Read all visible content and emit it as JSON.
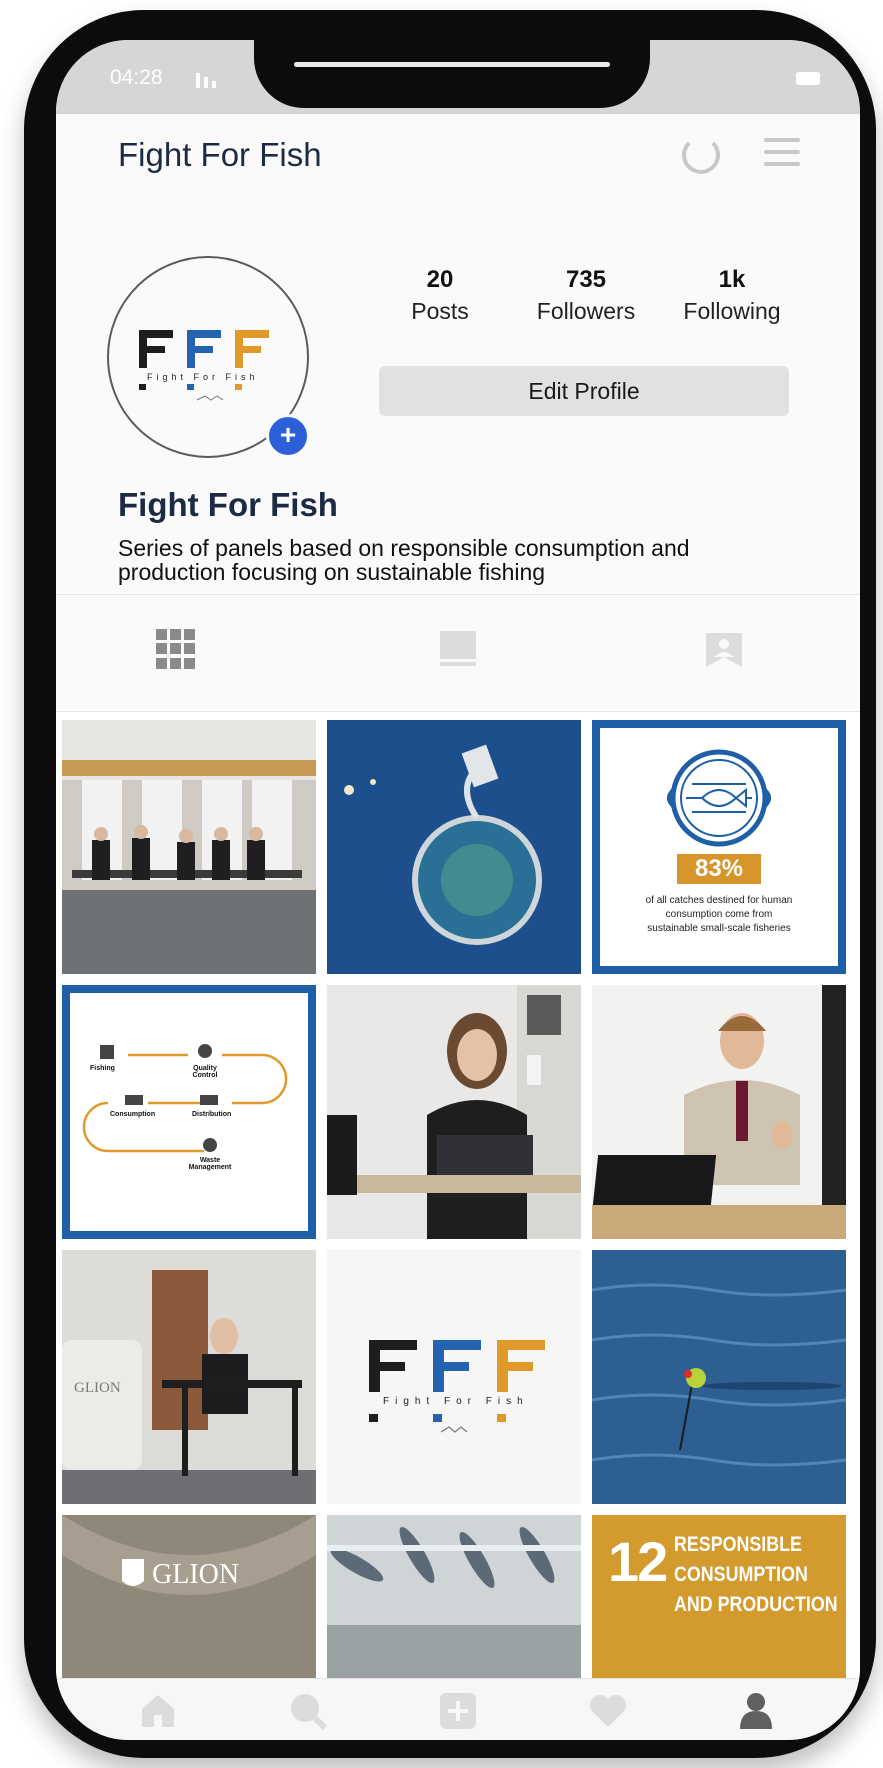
{
  "status": {
    "time": "04:28"
  },
  "header": {
    "title": "Fight For Fish"
  },
  "profile": {
    "stats": [
      {
        "value": "20",
        "label": "Posts"
      },
      {
        "value": "735",
        "label": "Followers"
      },
      {
        "value": "1k",
        "label": "Following"
      }
    ],
    "edit_label": "Edit Profile",
    "name": "Fight For Fish",
    "bio": "Series of panels based on responsible consumption and production focusing on sustainable fishing",
    "logo_letters": "FFF",
    "logo_tagline": "Fight For Fish"
  },
  "posts": {
    "stat_percent": "83%",
    "stat_caption": "of all catches destined for human consumption come from sustainable small-scale fisheries",
    "flow_labels": [
      "Fishing",
      "Quality Control",
      "Consumption",
      "Distribution",
      "Waste Management"
    ],
    "glion_sign": "GLION",
    "banner_time_label": "",
    "sdg_number": "12",
    "sdg_lines": [
      "RESPONSIBLE",
      "CONSUMPTION",
      "AND PRODUCTION"
    ]
  },
  "colors": {
    "accent_blue": "#1f5fa5",
    "accent_orange": "#e09a2c",
    "plus_blue": "#2d5fd8",
    "sdg_gold": "#d39a2d"
  }
}
